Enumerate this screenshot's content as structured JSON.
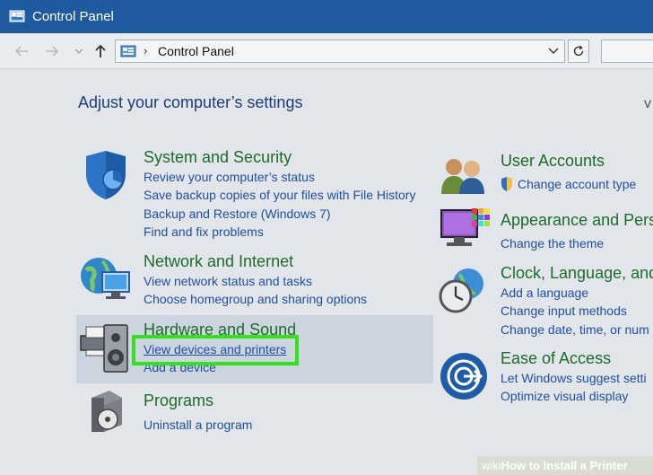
{
  "window": {
    "title": "Control Panel"
  },
  "address": {
    "path": "Control Panel"
  },
  "main": {
    "heading": "Adjust your computer’s settings",
    "view_by": "V"
  },
  "categories": {
    "system_security": {
      "title": "System and Security",
      "links": [
        "Review your computer’s status",
        "Save backup copies of your files with File History",
        "Backup and Restore (Windows 7)",
        "Find and fix problems"
      ]
    },
    "network": {
      "title": "Network and Internet",
      "links": [
        "View network status and tasks",
        "Choose homegroup and sharing options"
      ]
    },
    "hardware": {
      "title": "Hardware and Sound",
      "links": [
        "View devices and printers",
        "Add a device"
      ]
    },
    "programs": {
      "title": "Programs",
      "links": [
        "Uninstall a program"
      ]
    },
    "user_accounts": {
      "title": "User Accounts",
      "links": [
        "Change account type"
      ]
    },
    "appearance": {
      "title": "Appearance and Pers",
      "links": [
        "Change the theme"
      ]
    },
    "clock": {
      "title": "Clock, Language, and",
      "links": [
        "Add a language",
        "Change input methods",
        "Change date, time, or num"
      ]
    },
    "ease": {
      "title": "Ease of Access",
      "links": [
        "Let Windows suggest setti",
        "Optimize visual display"
      ]
    }
  },
  "watermark": {
    "wiki": "wiki",
    "text": "How to Install a Printer"
  },
  "colors": {
    "titlebar": "#1f5a9e",
    "link": "#1f4f9c",
    "category": "#1d6b2a",
    "highlight": "#34e21c"
  }
}
